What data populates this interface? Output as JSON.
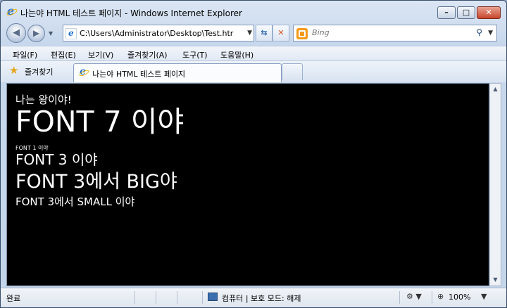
{
  "window": {
    "title": "나는야 HTML 테스트 페이지 - Windows Internet Explorer",
    "controls": {
      "minimize": "–",
      "maximize": "□",
      "close": "✕"
    }
  },
  "address_bar": {
    "url": "C:\\Users\\Administrator\\Desktop\\Test.htr",
    "refresh_icon": "refresh-icon",
    "stop_icon": "stop-icon"
  },
  "search": {
    "placeholder": "Bing",
    "go_glyph": "⚲"
  },
  "menu": {
    "items": [
      "파일(F)",
      "편집(E)",
      "보기(V)",
      "즐겨찾기(A)",
      "도구(T)",
      "도움말(H)"
    ]
  },
  "favorites": {
    "label": "즐겨찾기"
  },
  "tab": {
    "label": "나는야 HTML 테스트 페이지"
  },
  "content": {
    "lines": [
      "나는 왕이야!",
      "FONT 7 이야",
      "FONT 1 이야",
      "FONT 3 이야",
      "FONT 3에서 BIG야",
      "FONT 3에서 SMALL 이야"
    ],
    "text_color": "#ffffff",
    "background_color": "#000000"
  },
  "status": {
    "left": "완료",
    "zone": "컴퓨터 | 보호 모드: 해제",
    "zoom": "100%"
  }
}
